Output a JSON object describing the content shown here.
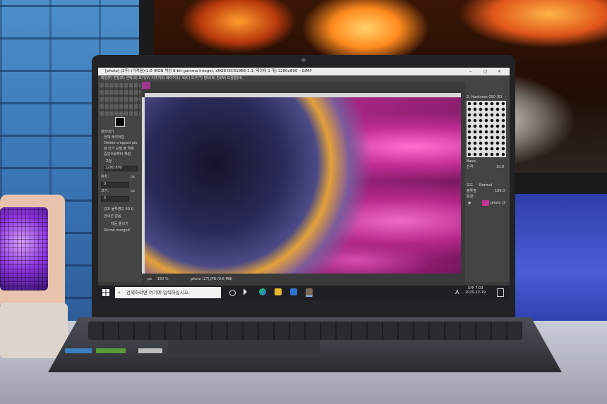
{
  "window": {
    "title": "[photo] (2주) (가져옴)-1.0 (RGB 색상 8-bit gamma integer, sRGB IEC61966-2.1, 레이어 1 개) 1280x800 – GIMP",
    "minimize": "–",
    "maximize": "□",
    "close": "✕"
  },
  "menubar": "파일(F)  편집(E)  선택(S)  보기(V)  이미지(I)  레이어(L)  색(C)  도구(T)  필터(R)  창(W)  도움말(H)",
  "toolbox": {
    "section": "잘라내기",
    "opt_current_layer": "현재 레이어만",
    "opt_delete_cropped": "Delete cropped pix",
    "opt_allow_growing": "잘 라기 요필 불 확용",
    "opt_center": "중앙으로부터 확장",
    "fixed_label": "고정",
    "fixed_value": "1280:800",
    "position_label": "위치:",
    "size_label": "크기:",
    "unit_px": "px",
    "zero": "0",
    "highlight": "강조 불투명도 50.0",
    "guides": "안내선 없음",
    "auto_shrink": "자동 줄이기",
    "shrink_merged": "Shrink merged"
  },
  "dock": {
    "brush_name": "2. Hardness 050 (51",
    "basic": "Basic,",
    "spacing_label": "간격",
    "spacing_value": "10.0",
    "mode_label": "모드",
    "mode_value": "Normal",
    "opacity_label": "불투명",
    "opacity_value": "100.0",
    "lock_label": "잠금:",
    "layer_name": "photo (2"
  },
  "status": {
    "unit": "px",
    "zoom": "150 %",
    "file": "photo (27).JPG (9.6 MB)"
  },
  "taskbar": {
    "search_placeholder": "검색하려면 여기에 입력하십시오.",
    "tray_ime": "A",
    "time": "오후 7:03",
    "date": "2020-12-19"
  }
}
